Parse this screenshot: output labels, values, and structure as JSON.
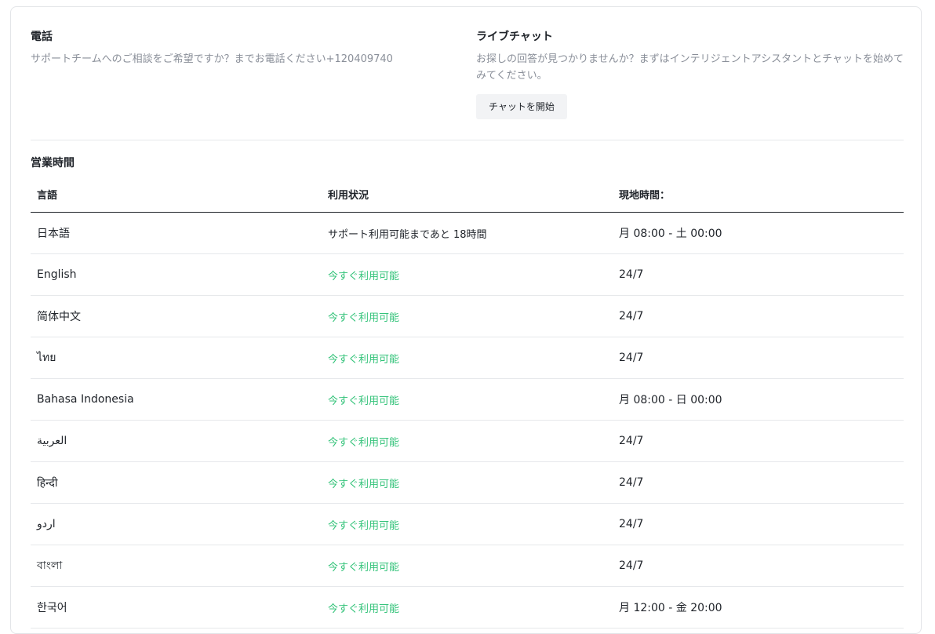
{
  "phone": {
    "title": "電話",
    "description": "サポートチームへのご相談をご希望ですか？までお電話ください+120409740"
  },
  "chat": {
    "title": "ライブチャット",
    "description": "お探しの回答が見つかりませんか？まずはインテリジェントアシスタントとチャットを始めてみてください。",
    "button_label": "チャットを開始"
  },
  "hours": {
    "title": "営業時間",
    "columns": [
      "言語",
      "利用状況",
      "現地時間："
    ],
    "rows": [
      {
        "language": "日本語",
        "status": "サポート利用可能まであと 18時間",
        "available": false,
        "time": "月 08:00 - 土 00:00"
      },
      {
        "language": "English",
        "status": "今すぐ利用可能",
        "available": true,
        "time": "24/7"
      },
      {
        "language": "简体中文",
        "status": "今すぐ利用可能",
        "available": true,
        "time": "24/7"
      },
      {
        "language": "ไทย",
        "status": "今すぐ利用可能",
        "available": true,
        "time": "24/7"
      },
      {
        "language": "Bahasa Indonesia",
        "status": "今すぐ利用可能",
        "available": true,
        "time": "月 08:00 - 日 00:00"
      },
      {
        "language": "العربية",
        "status": "今すぐ利用可能",
        "available": true,
        "time": "24/7"
      },
      {
        "language": "हिन्दी",
        "status": "今すぐ利用可能",
        "available": true,
        "time": "24/7"
      },
      {
        "language": "اردو",
        "status": "今すぐ利用可能",
        "available": true,
        "time": "24/7"
      },
      {
        "language": "বাংলা",
        "status": "今すぐ利用可能",
        "available": true,
        "time": "24/7"
      },
      {
        "language": "한국어",
        "status": "今すぐ利用可能",
        "available": true,
        "time": "月 12:00 - 金 20:00"
      }
    ]
  },
  "colors": {
    "available": "#34c37a",
    "text": "#1f2329",
    "muted": "#8a8f99",
    "divider": "#e6e8eb"
  }
}
